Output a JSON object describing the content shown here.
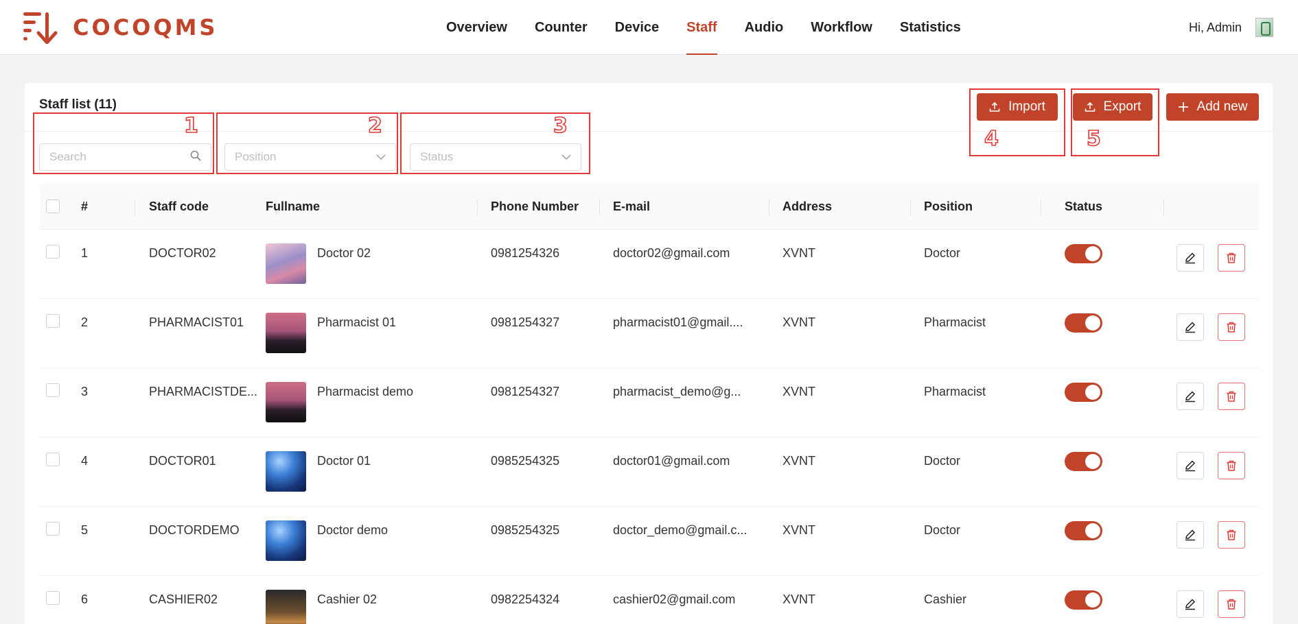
{
  "app": {
    "logo_text": "COCOQMS",
    "brand_color": "#c0432a",
    "accent_annotation": "#e53935"
  },
  "nav": {
    "items": [
      {
        "label": "Overview"
      },
      {
        "label": "Counter"
      },
      {
        "label": "Device"
      },
      {
        "label": "Staff",
        "active": true
      },
      {
        "label": "Audio"
      },
      {
        "label": "Workflow"
      },
      {
        "label": "Statistics"
      }
    ]
  },
  "user": {
    "greeting": "Hi, Admin"
  },
  "card": {
    "title": "Staff list (11)"
  },
  "toolbar": {
    "import_label": "Import",
    "export_label": "Export",
    "add_label": "Add new"
  },
  "filters": {
    "search_placeholder": "Search",
    "position_placeholder": "Position",
    "status_placeholder": "Status"
  },
  "annotations": [
    "1",
    "2",
    "3",
    "4",
    "5"
  ],
  "table": {
    "headers": {
      "index": "#",
      "code": "Staff code",
      "fullname": "Fullname",
      "phone": "Phone Number",
      "email": "E-mail",
      "address": "Address",
      "position": "Position",
      "status": "Status"
    },
    "rows": [
      {
        "index": "1",
        "code": "DOCTOR02",
        "fullname": "Doctor 02",
        "phone": "0981254326",
        "email": "doctor02@gmail.com",
        "address": "XVNT",
        "position": "Doctor",
        "status": true,
        "thumb": "clouds"
      },
      {
        "index": "2",
        "code": "PHARMACIST01",
        "fullname": "Pharmacist 01",
        "phone": "0981254327",
        "email": "pharmacist01@gmail....",
        "address": "XVNT",
        "position": "Pharmacist",
        "status": true,
        "thumb": "sunset"
      },
      {
        "index": "3",
        "code": "PHARMACISTDE...",
        "fullname": "Pharmacist demo",
        "phone": "0981254327",
        "email": "pharmacist_demo@g...",
        "address": "XVNT",
        "position": "Pharmacist",
        "status": true,
        "thumb": "sunset"
      },
      {
        "index": "4",
        "code": "DOCTOR01",
        "fullname": "Doctor 01",
        "phone": "0985254325",
        "email": "doctor01@gmail.com",
        "address": "XVNT",
        "position": "Doctor",
        "status": true,
        "thumb": "planet"
      },
      {
        "index": "5",
        "code": "DOCTORDEMO",
        "fullname": "Doctor demo",
        "phone": "0985254325",
        "email": "doctor_demo@gmail.c...",
        "address": "XVNT",
        "position": "Doctor",
        "status": true,
        "thumb": "planet"
      },
      {
        "index": "6",
        "code": "CASHIER02",
        "fullname": "Cashier 02",
        "phone": "0982254324",
        "email": "cashier02@gmail.com",
        "address": "XVNT",
        "position": "Cashier",
        "status": true,
        "thumb": "night"
      }
    ]
  }
}
